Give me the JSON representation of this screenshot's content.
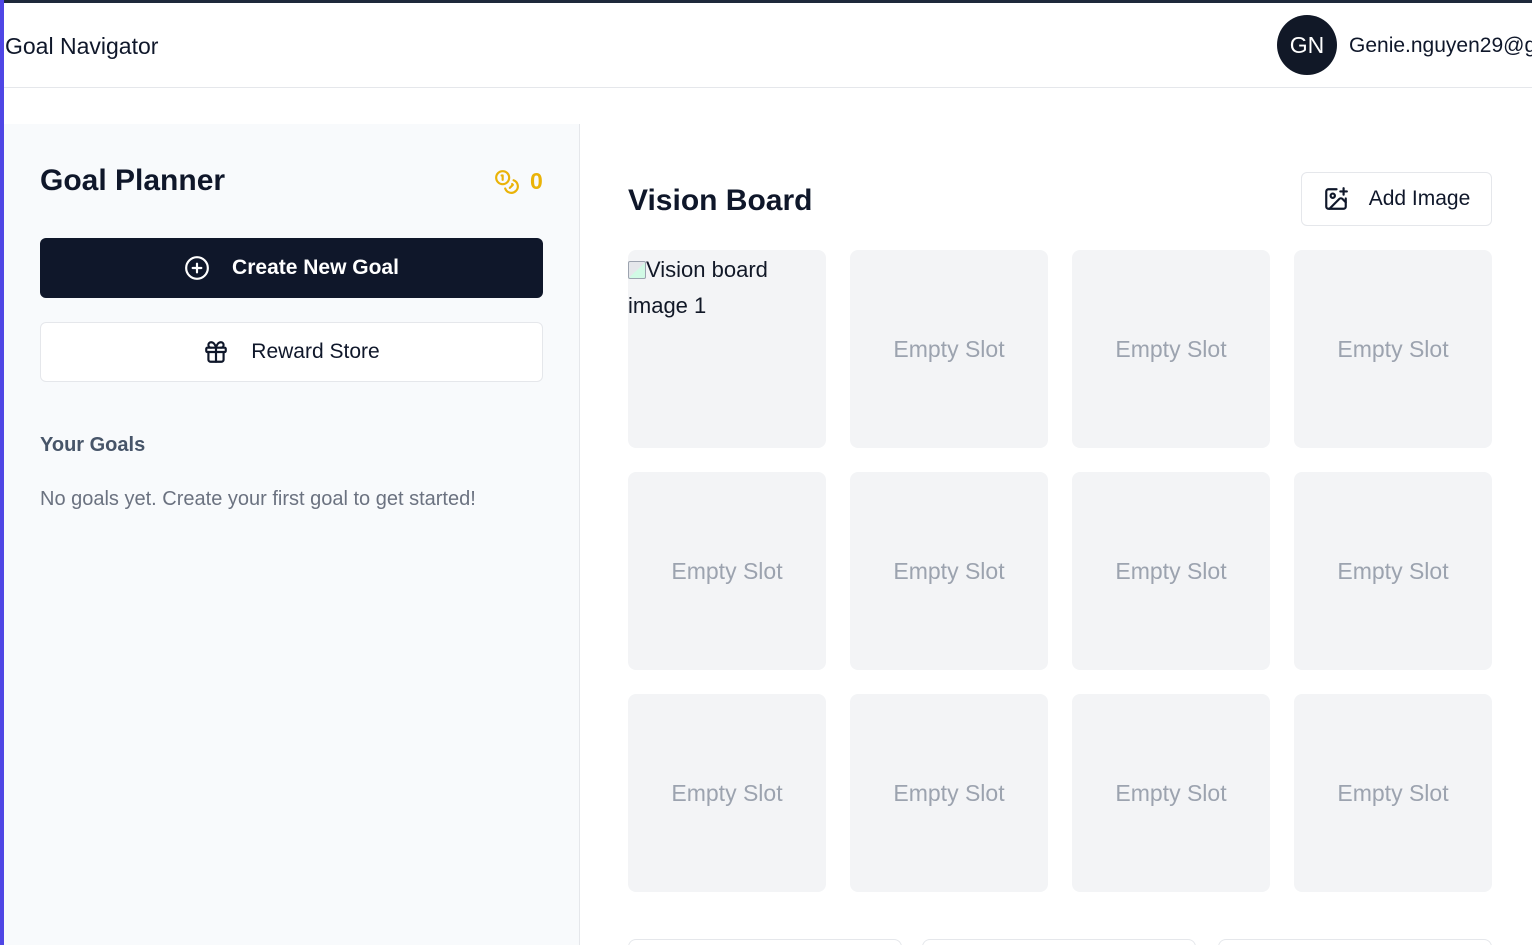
{
  "header": {
    "app_title": "Goal Navigator",
    "avatar_initials": "GN",
    "user_email": "Genie.nguyen29@g"
  },
  "sidebar": {
    "title": "Goal Planner",
    "coin_count": "0",
    "create_goal_label": "Create New Goal",
    "reward_store_label": "Reward Store",
    "goals_heading": "Your Goals",
    "goals_empty_text": "No goals yet. Create your first goal to get started!"
  },
  "vision_board": {
    "title": "Vision Board",
    "add_image_label": "Add Image",
    "slots": [
      {
        "type": "image",
        "alt": "Vision board image 1"
      },
      {
        "type": "empty",
        "label": "Empty Slot"
      },
      {
        "type": "empty",
        "label": "Empty Slot"
      },
      {
        "type": "empty",
        "label": "Empty Slot"
      },
      {
        "type": "empty",
        "label": "Empty Slot"
      },
      {
        "type": "empty",
        "label": "Empty Slot"
      },
      {
        "type": "empty",
        "label": "Empty Slot"
      },
      {
        "type": "empty",
        "label": "Empty Slot"
      },
      {
        "type": "empty",
        "label": "Empty Slot"
      },
      {
        "type": "empty",
        "label": "Empty Slot"
      },
      {
        "type": "empty",
        "label": "Empty Slot"
      },
      {
        "type": "empty",
        "label": "Empty Slot"
      }
    ]
  },
  "colors": {
    "primary": "#0f172a",
    "coin_accent": "#eab308",
    "slot_bg": "#f3f4f6",
    "slot_text": "#9ca3af"
  },
  "icons": {
    "coins": "coins-icon",
    "create": "plus-circle-icon",
    "reward": "gift-icon",
    "add_image": "image-plus-icon"
  }
}
